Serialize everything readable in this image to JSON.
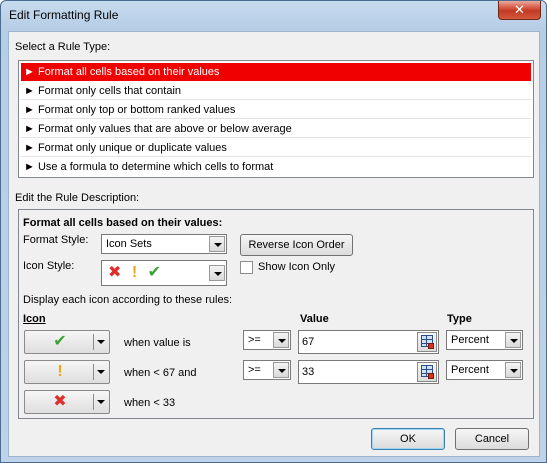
{
  "window": {
    "title": "Edit Formatting Rule",
    "close_glyph": "✕"
  },
  "rule_type_section": {
    "label": "Select a Rule Type:",
    "items": [
      {
        "label": "► Format all cells based on their values",
        "selected": true
      },
      {
        "label": "► Format only cells that contain",
        "selected": false
      },
      {
        "label": "► Format only top or bottom ranked values",
        "selected": false
      },
      {
        "label": "► Format only values that are above or below average",
        "selected": false
      },
      {
        "label": "► Format only unique or duplicate values",
        "selected": false
      },
      {
        "label": "► Use a formula to determine which cells to format",
        "selected": false
      }
    ]
  },
  "description_section": {
    "label": "Edit the Rule Description:",
    "heading": "Format all cells based on their values:",
    "format_style_label": "Format Style:",
    "format_style_value": "Icon Sets",
    "reverse_button": "Reverse Icon Order",
    "icon_style_label": "Icon Style:",
    "icon_style_icons": [
      "✖",
      "!",
      "✔"
    ],
    "show_icon_only_label": "Show Icon Only",
    "show_icon_only_checked": false,
    "display_rules_label": "Display each icon according to these rules:",
    "col_icon": "Icon",
    "col_value": "Value",
    "col_type": "Type",
    "rules": [
      {
        "icon": "✔",
        "icon_name": "check-icon",
        "condition": "when value is",
        "operator": ">=",
        "value": "67",
        "type": "Percent"
      },
      {
        "icon": "!",
        "icon_name": "exclamation-icon",
        "condition": "when < 67 and",
        "operator": ">=",
        "value": "33",
        "type": "Percent"
      },
      {
        "icon": "✖",
        "icon_name": "x-icon",
        "condition": "when < 33"
      }
    ]
  },
  "buttons": {
    "ok": "OK",
    "cancel": "Cancel"
  },
  "colors": {
    "selection": "#f00000",
    "check": "#3aa331",
    "exclamation": "#f2a51b",
    "x": "#e0302e"
  }
}
